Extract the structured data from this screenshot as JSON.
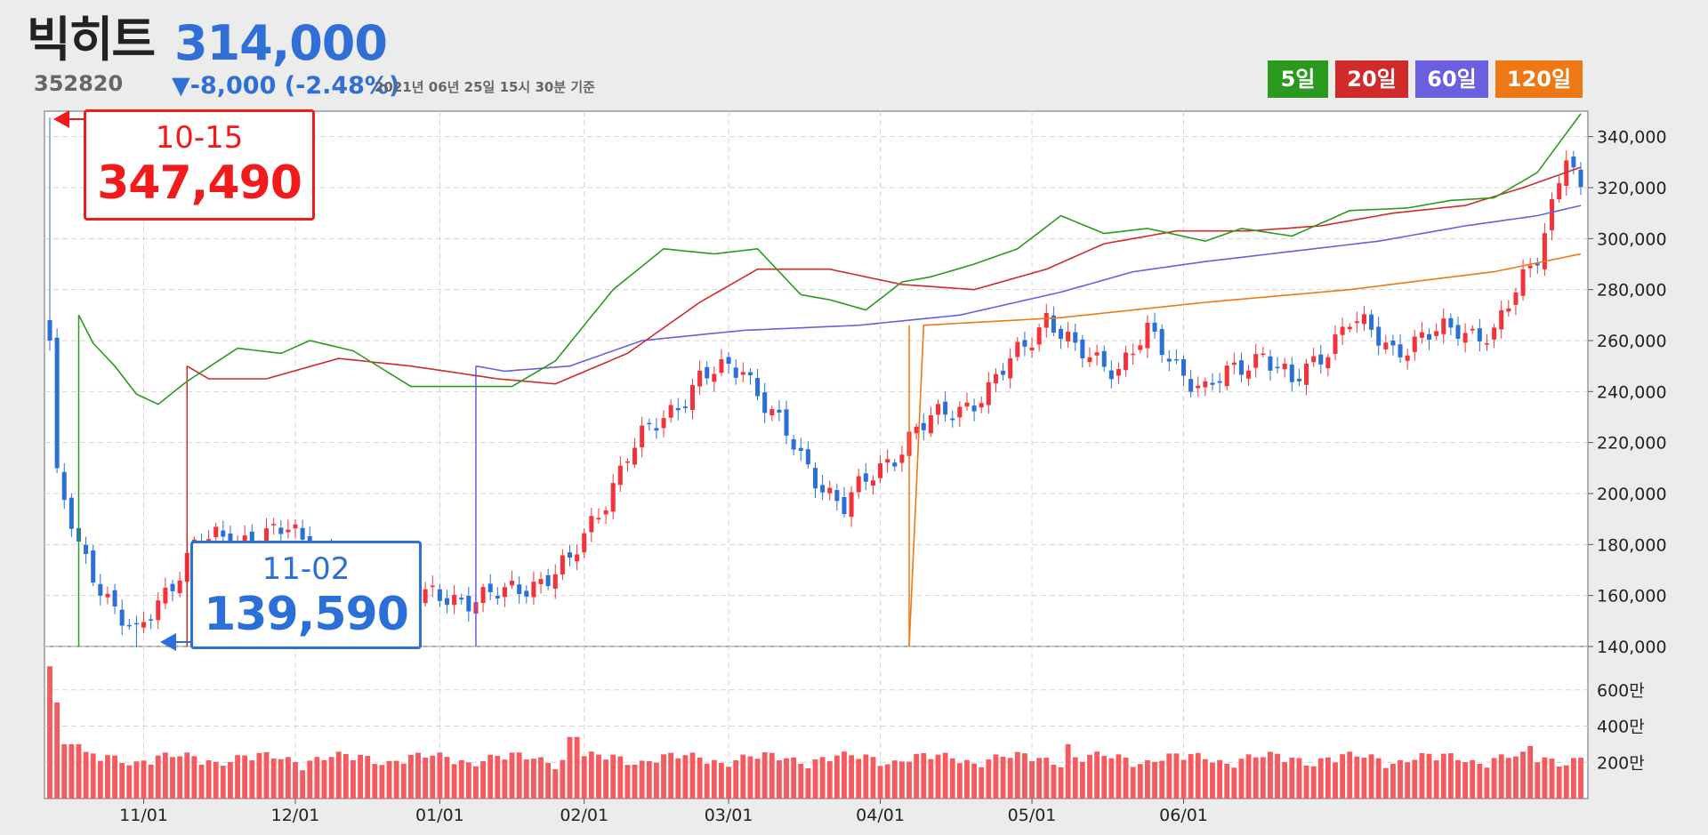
{
  "header": {
    "name": "빅히트",
    "price": "314,000",
    "code": "352820",
    "change": "▼-8,000 (-2.48%)",
    "timestamp": "2021년 06년 25일 15시 30분 기준"
  },
  "legend": [
    {
      "label": "5일",
      "color": "#2a9a1f"
    },
    {
      "label": "20일",
      "color": "#d12a2a"
    },
    {
      "label": "60일",
      "color": "#6a5fe0"
    },
    {
      "label": "120일",
      "color": "#ee7814"
    }
  ],
  "annotations": {
    "high": {
      "date": "10-15",
      "value": "347,490"
    },
    "low": {
      "date": "11-02",
      "value": "139,590"
    }
  },
  "colors": {
    "up": "#f4323a",
    "down": "#2b6fd8",
    "volume": "#f55a5f",
    "ma5": "#2a9a1f",
    "ma20": "#d12a2a",
    "ma60": "#6a5fe0",
    "ma120": "#ee7814"
  },
  "chart_data": {
    "type": "candlestick",
    "x_ticks": [
      "11/01",
      "12/01",
      "01/01",
      "02/01",
      "03/01",
      "04/01",
      "05/01",
      "06/01"
    ],
    "y_ticks": [
      "340,000",
      "320,000",
      "300,000",
      "280,000",
      "260,000",
      "240,000",
      "220,000",
      "200,000",
      "180,000",
      "160,000",
      "140,000"
    ],
    "ylim": [
      140000,
      350000
    ],
    "volume_ticks": [
      "600만",
      "400만",
      "200만"
    ],
    "volume_unit": "만",
    "volume_ylim": [
      0,
      800
    ],
    "close_anchors": [
      [
        0,
        260000
      ],
      [
        1,
        205000
      ],
      [
        4,
        178000
      ],
      [
        8,
        160000
      ],
      [
        12,
        143000
      ],
      [
        20,
        180000
      ],
      [
        33,
        185000
      ],
      [
        48,
        158000
      ],
      [
        63,
        160000
      ],
      [
        72,
        172000
      ],
      [
        80,
        215000
      ],
      [
        90,
        245000
      ],
      [
        96,
        250000
      ],
      [
        104,
        213000
      ],
      [
        110,
        195000
      ],
      [
        120,
        225000
      ],
      [
        130,
        240000
      ],
      [
        138,
        270000
      ],
      [
        142,
        255000
      ],
      [
        148,
        250000
      ],
      [
        152,
        262000
      ],
      [
        160,
        240000
      ],
      [
        168,
        256000
      ],
      [
        172,
        242000
      ],
      [
        180,
        268000
      ],
      [
        186,
        257000
      ],
      [
        195,
        265000
      ],
      [
        200,
        262000
      ],
      [
        206,
        295000
      ],
      [
        210,
        333000
      ],
      [
        212,
        315000
      ]
    ],
    "ma_start_index": {
      "ma5": 4,
      "ma20": 19,
      "ma60": 59,
      "ma120": 119
    },
    "ma_values": {
      "ma5": [
        [
          4,
          270000
        ],
        [
          6,
          259000
        ],
        [
          9,
          250000
        ],
        [
          12,
          239000
        ],
        [
          15,
          235000
        ],
        [
          19,
          244000
        ],
        [
          26,
          257000
        ],
        [
          32,
          255000
        ],
        [
          36,
          260000
        ],
        [
          42,
          256000
        ],
        [
          50,
          242000
        ],
        [
          58,
          242000
        ],
        [
          64,
          242000
        ],
        [
          70,
          252000
        ],
        [
          78,
          280000
        ],
        [
          85,
          296000
        ],
        [
          92,
          294000
        ],
        [
          98,
          296000
        ],
        [
          104,
          278000
        ],
        [
          108,
          276000
        ],
        [
          113,
          272000
        ],
        [
          118,
          283000
        ],
        [
          122,
          285000
        ],
        [
          128,
          290000
        ],
        [
          134,
          296000
        ],
        [
          140,
          309000
        ],
        [
          146,
          302000
        ],
        [
          152,
          304000
        ],
        [
          160,
          299000
        ],
        [
          165,
          304000
        ],
        [
          172,
          301000
        ],
        [
          180,
          311000
        ],
        [
          188,
          312000
        ],
        [
          194,
          315000
        ],
        [
          200,
          316000
        ],
        [
          206,
          326000
        ],
        [
          212,
          349000
        ]
      ],
      "ma20": [
        [
          19,
          250000
        ],
        [
          22,
          245000
        ],
        [
          30,
          245000
        ],
        [
          40,
          253000
        ],
        [
          50,
          250000
        ],
        [
          62,
          245000
        ],
        [
          70,
          243000
        ],
        [
          80,
          255000
        ],
        [
          90,
          275000
        ],
        [
          98,
          288000
        ],
        [
          108,
          288000
        ],
        [
          118,
          282000
        ],
        [
          128,
          280000
        ],
        [
          138,
          288000
        ],
        [
          146,
          298000
        ],
        [
          156,
          303000
        ],
        [
          166,
          303000
        ],
        [
          176,
          305000
        ],
        [
          186,
          310000
        ],
        [
          196,
          313000
        ],
        [
          204,
          320000
        ],
        [
          212,
          328000
        ]
      ],
      "ma60": [
        [
          59,
          250000
        ],
        [
          63,
          248000
        ],
        [
          72,
          250000
        ],
        [
          82,
          260000
        ],
        [
          96,
          264000
        ],
        [
          112,
          266000
        ],
        [
          126,
          270000
        ],
        [
          140,
          279000
        ],
        [
          150,
          287000
        ],
        [
          160,
          291000
        ],
        [
          172,
          295000
        ],
        [
          184,
          299000
        ],
        [
          196,
          305000
        ],
        [
          206,
          309000
        ],
        [
          212,
          313000
        ]
      ],
      "ma120": [
        [
          119,
          140000
        ],
        [
          121,
          266000
        ],
        [
          140,
          269000
        ],
        [
          160,
          275000
        ],
        [
          180,
          280000
        ],
        [
          200,
          287000
        ],
        [
          212,
          294000
        ]
      ]
    }
  }
}
